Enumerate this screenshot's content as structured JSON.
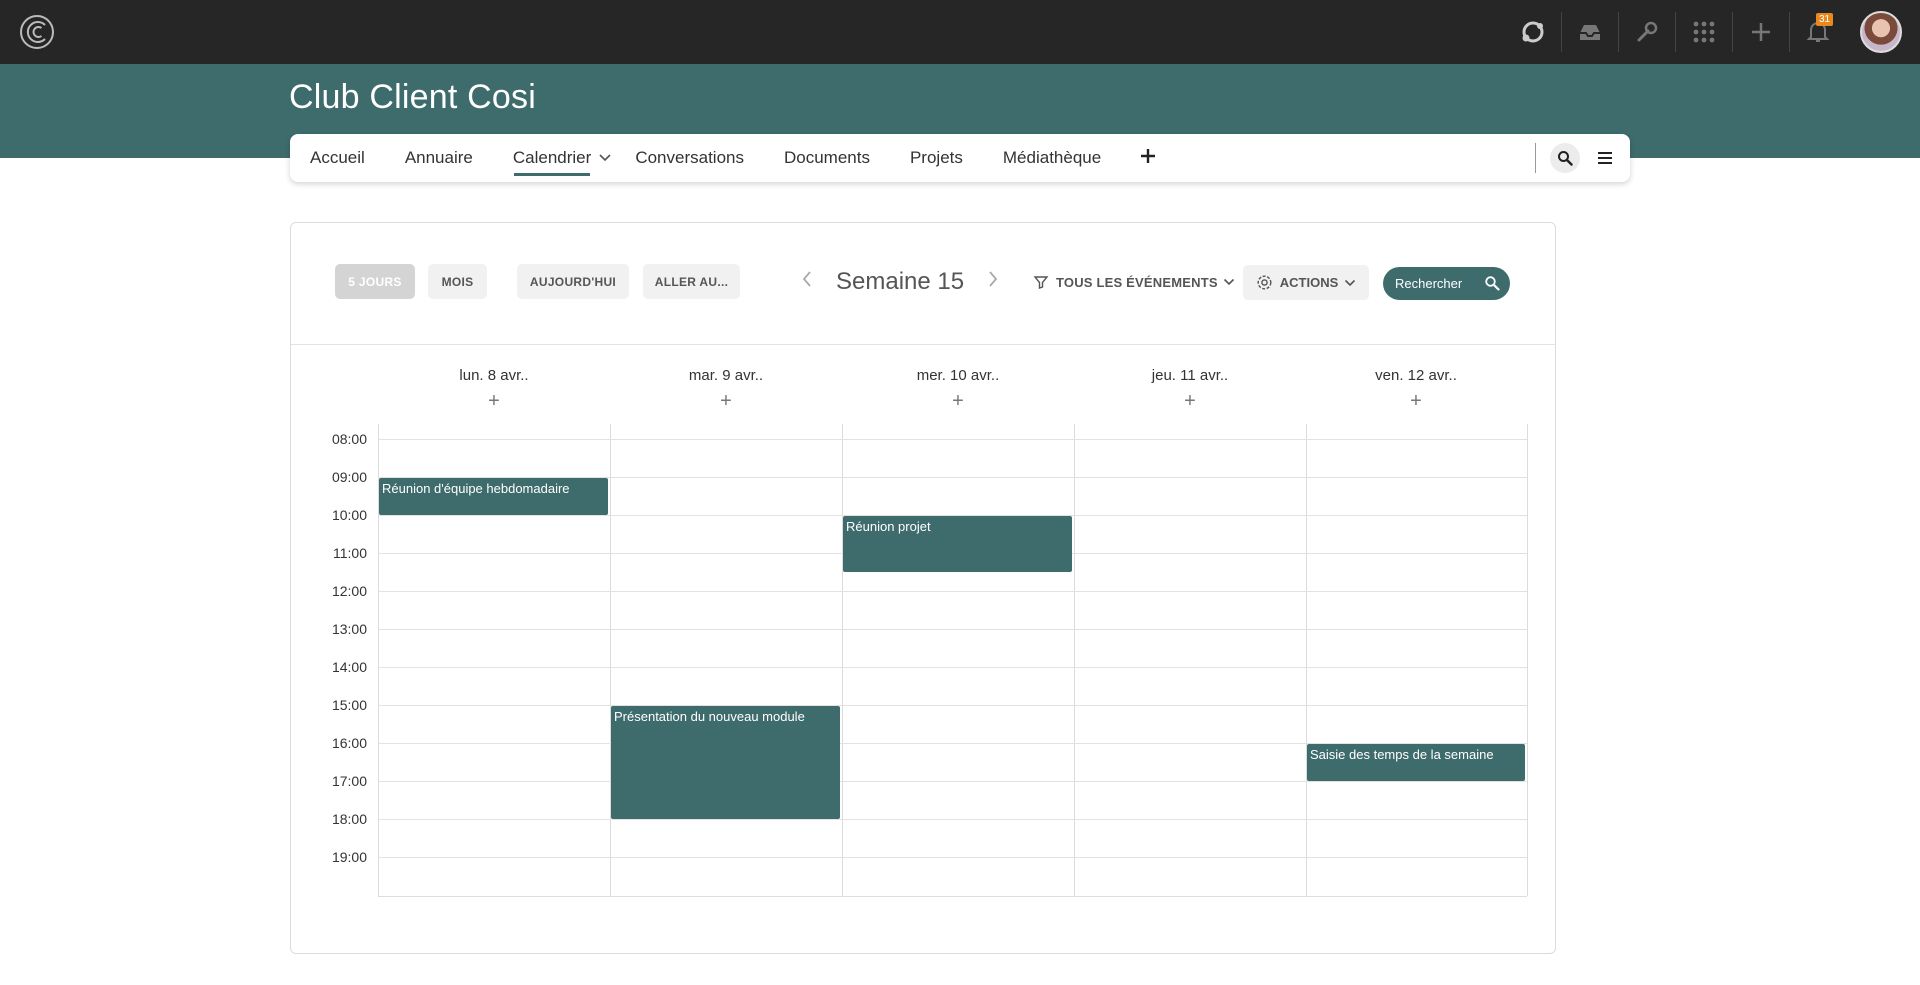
{
  "topbar": {
    "notification_count": "31",
    "icons": [
      "support-icon",
      "inbox-icon",
      "tools-icon",
      "apps-grid-icon",
      "plus-icon",
      "bell-icon"
    ]
  },
  "space": {
    "title": "Club Client Cosi"
  },
  "nav": {
    "items": [
      {
        "label": "Accueil"
      },
      {
        "label": "Annuaire"
      },
      {
        "label": "Calendrier",
        "active": true
      },
      {
        "label": "Conversations"
      },
      {
        "label": "Documents"
      },
      {
        "label": "Projets"
      },
      {
        "label": "Médiathèque"
      }
    ]
  },
  "toolbar": {
    "five_days": "5 JOURS",
    "month": "MOIS",
    "today": "AUJOURD'HUI",
    "goto": "ALLER AU...",
    "week_label": "Semaine 15",
    "filter_label": "TOUS LES ÉVÉNEMENTS",
    "actions_label": "ACTIONS",
    "search_label": "Rechercher"
  },
  "calendar": {
    "days": [
      "lun. 8 avr..",
      "mar. 9 avr..",
      "mer. 10 avr..",
      "jeu. 11 avr..",
      "ven. 12 avr.."
    ],
    "hours": [
      "08:00",
      "09:00",
      "10:00",
      "11:00",
      "12:00",
      "13:00",
      "14:00",
      "15:00",
      "16:00",
      "17:00",
      "18:00",
      "19:00"
    ],
    "events": [
      {
        "title": "Réunion d'équipe hebdomadaire",
        "day": 0,
        "start": 9,
        "end": 10
      },
      {
        "title": "Réunion projet",
        "day": 2,
        "start": 10,
        "end": 11.5
      },
      {
        "title": "Présentation du nouveau module",
        "day": 1,
        "start": 15,
        "end": 18
      },
      {
        "title": "Saisie des temps de la semaine",
        "day": 4,
        "start": 16,
        "end": 17
      }
    ]
  },
  "colors": {
    "accent": "#3e6b6c",
    "topbar": "#262626",
    "badge": "#e8891f"
  }
}
